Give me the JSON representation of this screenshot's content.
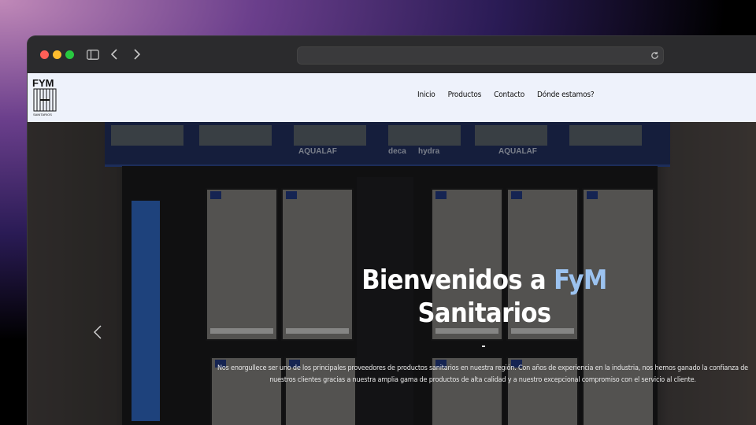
{
  "browser": {
    "url": ""
  },
  "site": {
    "logo_text": "FYM",
    "logo_subtext": "SANITARIOS"
  },
  "nav": {
    "items": [
      {
        "label": "Inicio"
      },
      {
        "label": "Productos"
      },
      {
        "label": "Contacto"
      },
      {
        "label": "Dónde estamos?"
      }
    ]
  },
  "hero": {
    "title_pre": "Bienvenidos a ",
    "title_accent": "FyM",
    "title_post": "Sanitarios",
    "accent_color": "#9cc3f0",
    "paragraph": "Nos enorgullece ser uno de los principales proveedores de productos sanitarios en nuestra región. Con años de experiencia en la industria, nos hemos ganado la confianza de nuestros clientes gracias a nuestra amplia gama de productos de alta calidad y a nuestro excepcional compromiso con el servicio al cliente.",
    "background_brands": [
      "AQUALAF",
      "deca",
      "hydra",
      "AQUALAF"
    ]
  }
}
